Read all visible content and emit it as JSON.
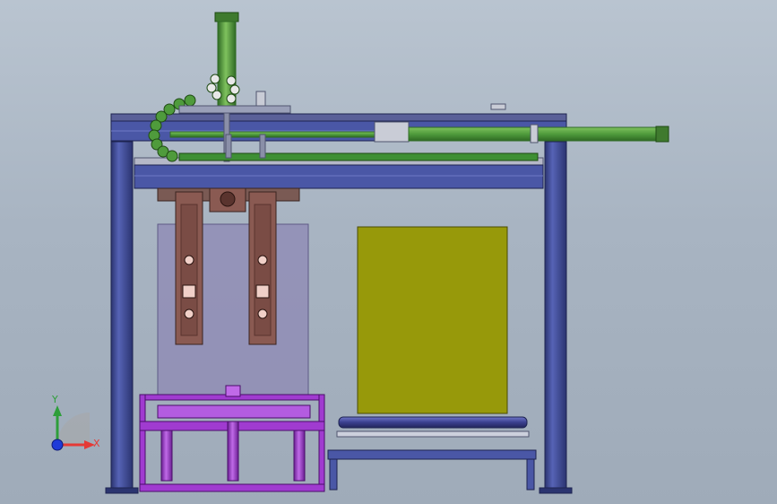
{
  "triad": {
    "x_label": "X",
    "y_label": "Y",
    "x_color": "#e53935",
    "y_color": "#2e9e3a",
    "z_color": "#1f3bd8"
  },
  "colors": {
    "frame": "#4a57a6",
    "frame_dark": "#2b3470",
    "rail_top": "#6a6f8a",
    "cylinder": "#4f9b3c",
    "cylinder_dark": "#2f6a24",
    "cable_chain": "#3e8f34",
    "gripper": "#8a5a52",
    "gripper_dark": "#5a342e",
    "glass_panel": "#8e88b4",
    "product_box": "#97990a",
    "roller_frame": "#a03bd0",
    "roller_frame_dark": "#6a1f92",
    "conveyor": "#3a3f8e"
  }
}
